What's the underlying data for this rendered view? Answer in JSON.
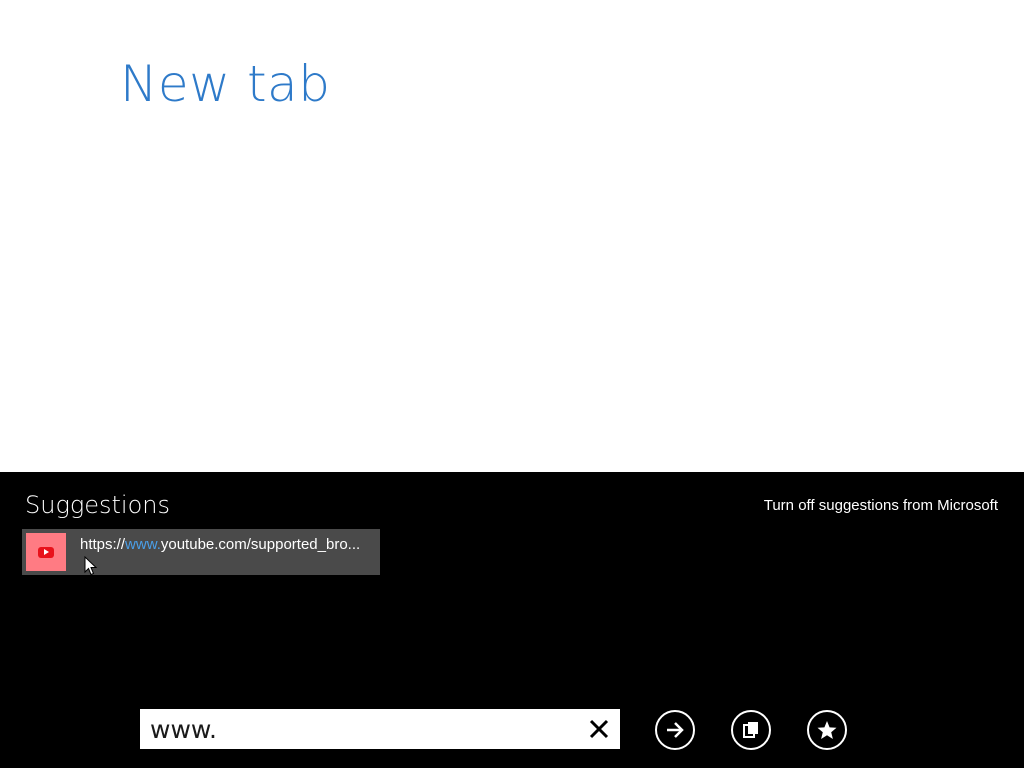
{
  "page": {
    "title": "New tab"
  },
  "suggestions": {
    "heading": "Suggestions",
    "turn_off_label": "Turn off suggestions from Microsoft",
    "items": [
      {
        "url_prefix": "https://",
        "url_match": "www.",
        "url_rest": "youtube.com/supported_bro...",
        "icon": "youtube-icon",
        "tile_color": "#ff7b83"
      }
    ]
  },
  "address_bar": {
    "value": "www.",
    "clear_icon": "close-icon"
  },
  "buttons": {
    "go_icon": "arrow-right-icon",
    "tabs_icon": "tabs-icon",
    "favorite_icon": "star-icon"
  },
  "colors": {
    "accent": "#2e7ac9",
    "appbar_background": "#000000",
    "suggestion_background": "#4a4a4a",
    "match_highlight": "#4a9fe8"
  }
}
